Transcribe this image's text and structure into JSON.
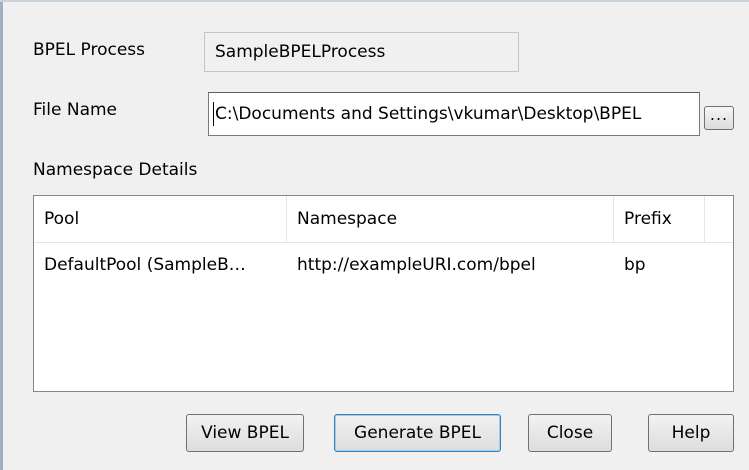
{
  "process": {
    "label": "BPEL Process",
    "value": "SampleBPELProcess"
  },
  "file": {
    "label": "File Name",
    "value": "C:\\Documents and Settings\\vkumar\\Desktop\\BPEL",
    "browse_label": "..."
  },
  "namespace_section": {
    "label": "Namespace Details"
  },
  "table": {
    "columns": [
      "Pool",
      "Namespace",
      "Prefix"
    ],
    "rows": [
      {
        "pool": "DefaultPool (SampleB…",
        "namespace": "http://exampleURI.com/bpel",
        "prefix": "bp"
      }
    ]
  },
  "buttons": {
    "view": "View BPEL",
    "generate": "Generate BPEL",
    "close": "Close",
    "help": "Help"
  }
}
